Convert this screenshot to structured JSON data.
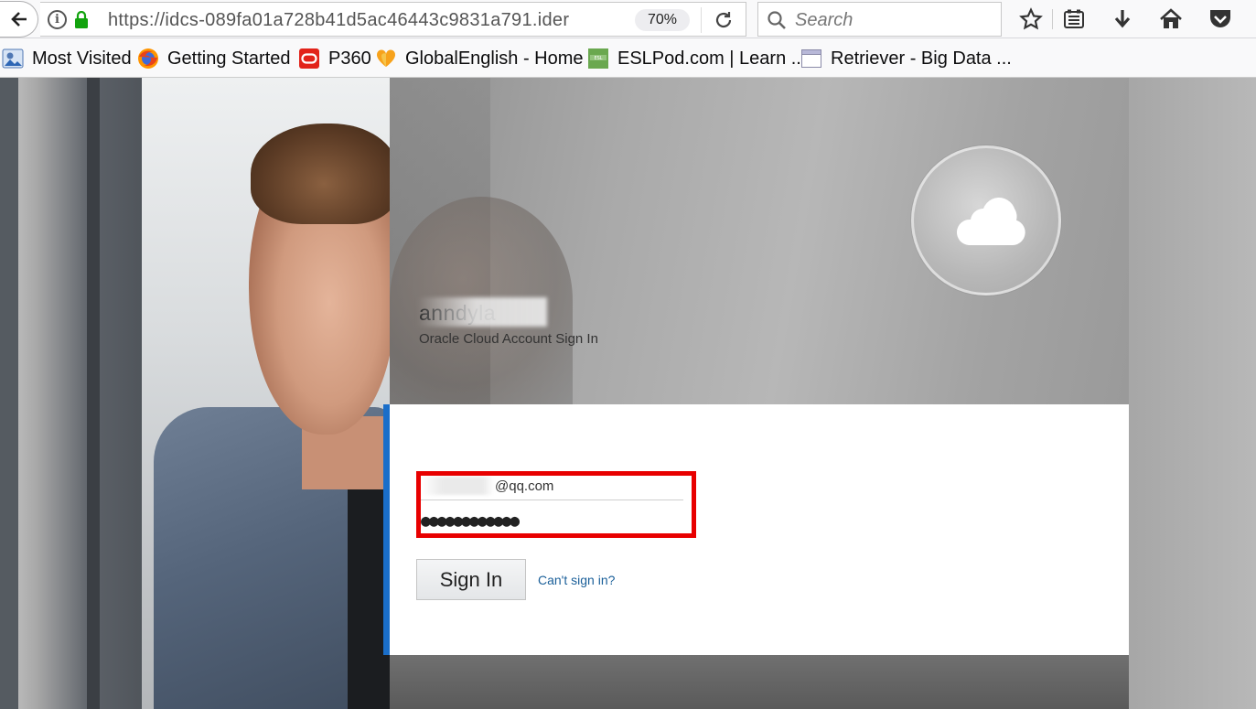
{
  "browser": {
    "url": "https://idcs-089fa01a728b41d5ac46443c9831a791.ider",
    "zoom": "70%",
    "search_placeholder": "Search"
  },
  "bookmarks": [
    {
      "label": "Most Visited",
      "icon": "most-visited-icon"
    },
    {
      "label": "Getting Started",
      "icon": "firefox-icon"
    },
    {
      "label": "P360",
      "icon": "oracle-icon"
    },
    {
      "label": "GlobalEnglish - Home",
      "icon": "globalenglish-icon"
    },
    {
      "label": "ESLPod.com | Learn ...",
      "icon": "eslpod-icon"
    },
    {
      "label": "Retriever - Big Data ...",
      "icon": "page-icon"
    }
  ],
  "login": {
    "account_name": "anndyla",
    "subtitle": "Oracle Cloud Account Sign In",
    "username_suffix": "@qq.com",
    "password_mask": "●●●●●●●●●●●●",
    "signin_label": "Sign In",
    "cant_signin_label": "Can't sign in?"
  },
  "colors": {
    "accent_bar": "#1a6ec9",
    "highlight": "#e80000",
    "link": "#1a5f99"
  }
}
